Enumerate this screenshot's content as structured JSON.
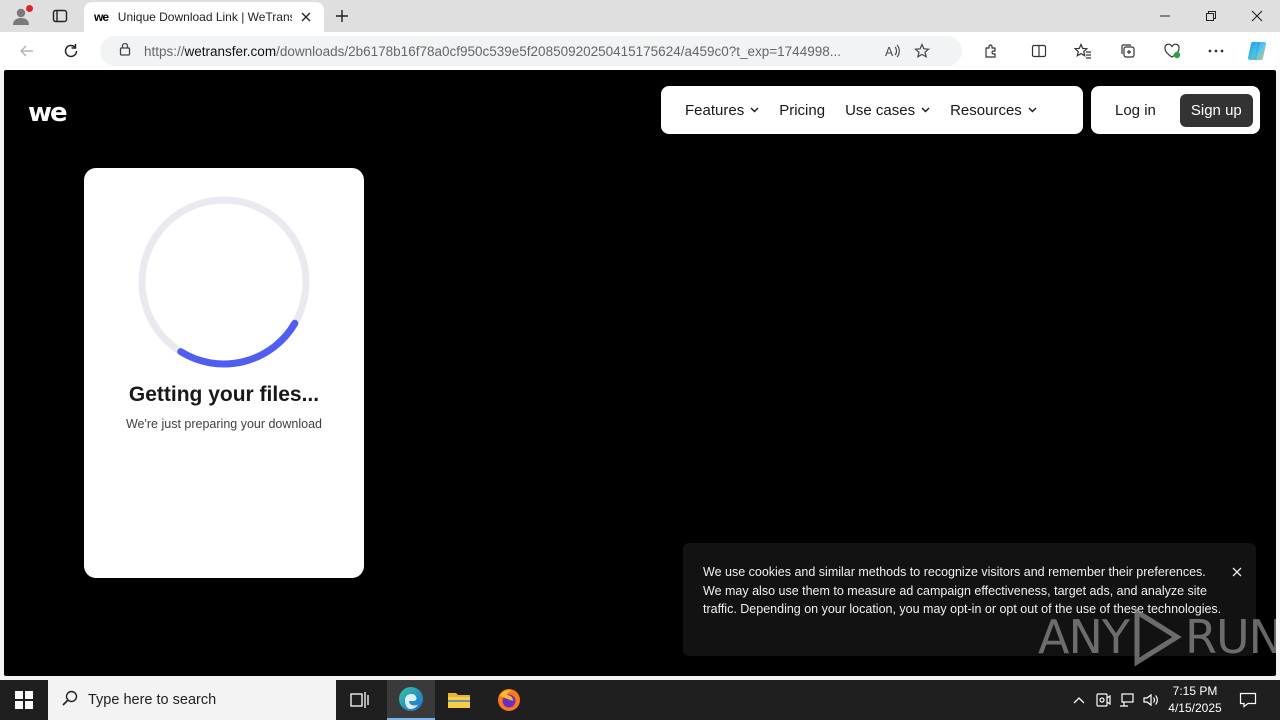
{
  "browser": {
    "tab_title": "Unique Download Link | WeTransfer",
    "tab_favicon": "we",
    "url_prefix": "https://",
    "url_host": "wetransfer.com",
    "url_path": "/downloads/2b6178b16f78a0cf950c539e5f20850920250415175624/a459c0?t_exp=1744998..."
  },
  "site": {
    "logo": "we",
    "nav": [
      {
        "label": "Features"
      },
      {
        "label": "Pricing"
      },
      {
        "label": "Use cases"
      },
      {
        "label": "Resources"
      }
    ],
    "login_label": "Log in",
    "signup_label": "Sign up"
  },
  "loader": {
    "title": "Getting your files...",
    "subtitle": "We're just preparing your download",
    "accent": "#4f5ef0",
    "track": "#e8eaef"
  },
  "cookie": {
    "text": "We use cookies and similar methods to recognize visitors and remember their preferences. We may also use them to measure ad campaign effectiveness, target ads, and analyze site traffic. Depending on your location, you may opt-in or opt out of the use of these technologies."
  },
  "watermark": {
    "left": "ANY",
    "right": "RUN"
  },
  "taskbar": {
    "search_placeholder": "Type here to search",
    "time": "7:15 PM",
    "date": "4/15/2025"
  }
}
